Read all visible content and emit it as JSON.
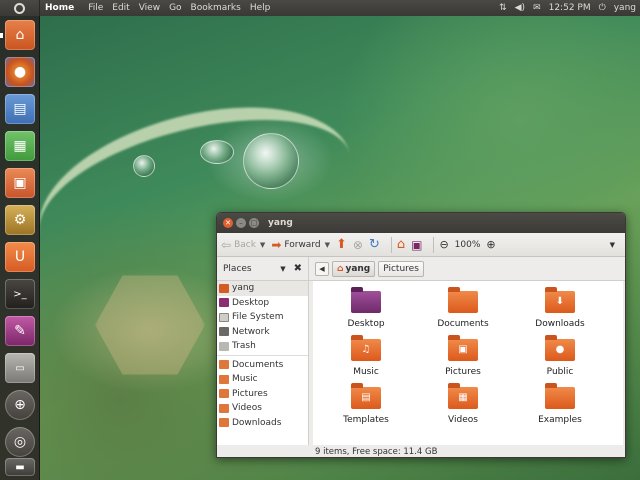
{
  "top_panel": {
    "app_name": "Home",
    "menu": [
      "File",
      "Edit",
      "View",
      "Go",
      "Bookmarks",
      "Help"
    ],
    "clock": "12:52 PM",
    "user": "yang",
    "tray_icons": [
      "network-icon",
      "volume-icon",
      "mail-icon",
      "power-icon"
    ]
  },
  "launcher": {
    "items": [
      {
        "name": "home-folder-icon",
        "color": "#d9642a"
      },
      {
        "name": "firefox-icon",
        "color": "#c7521f"
      },
      {
        "name": "writer-icon",
        "color": "#3d6fb3"
      },
      {
        "name": "calc-icon",
        "color": "#3f9a3a"
      },
      {
        "name": "impress-icon",
        "color": "#c8552a"
      },
      {
        "name": "software-center-icon",
        "color": "#b08a2e"
      },
      {
        "name": "ubuntu-one-icon",
        "color": "#dd6a2a"
      },
      {
        "name": "terminal-icon",
        "color": "#2e2b29"
      },
      {
        "name": "appearance-icon",
        "color": "#8a2d75"
      },
      {
        "name": "workspace-switcher-icon",
        "color": "#7a7874"
      },
      {
        "name": "apps-lens-icon",
        "color": "#55524d"
      },
      {
        "name": "files-lens-icon",
        "color": "#55524d"
      },
      {
        "name": "trash-icon",
        "color": "#4a4845"
      }
    ]
  },
  "window": {
    "title": "yang",
    "toolbar": {
      "back": "Back",
      "forward": "Forward",
      "zoom": "100%"
    },
    "places_label": "Places",
    "breadcrumbs": [
      "yang",
      "Pictures"
    ],
    "sidebar": {
      "group1": [
        "yang",
        "Desktop",
        "File System",
        "Network",
        "Trash"
      ],
      "group2": [
        "Documents",
        "Music",
        "Pictures",
        "Videos",
        "Downloads"
      ]
    },
    "files": [
      {
        "label": "Desktop",
        "emblem": ""
      },
      {
        "label": "Documents",
        "emblem": ""
      },
      {
        "label": "Downloads",
        "emblem": "⬇"
      },
      {
        "label": "Music",
        "emblem": "♫"
      },
      {
        "label": "Pictures",
        "emblem": "▣"
      },
      {
        "label": "Public",
        "emblem": "●"
      },
      {
        "label": "Templates",
        "emblem": "▤"
      },
      {
        "label": "Videos",
        "emblem": "▦"
      },
      {
        "label": "Examples",
        "emblem": ""
      }
    ],
    "status": "9 items, Free space: 11.4 GB"
  }
}
